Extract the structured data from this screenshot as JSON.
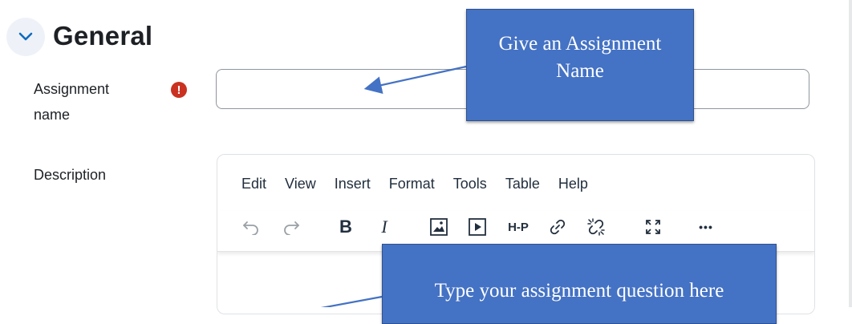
{
  "section": {
    "title": "General"
  },
  "fields": {
    "assignment_name": {
      "label": "Assignment name",
      "label_line1": "Assignment",
      "label_line2": "name",
      "required_icon": "!",
      "value": ""
    },
    "description": {
      "label": "Description"
    }
  },
  "editor": {
    "menu": [
      "Edit",
      "View",
      "Insert",
      "Format",
      "Tools",
      "Table",
      "Help"
    ],
    "toolbar": {
      "undo": "undo-icon",
      "redo": "redo-icon",
      "bold": "B",
      "italic": "I",
      "image": "image-icon",
      "media": "media-icon",
      "h5p": "H-P",
      "link": "link-icon",
      "unlink": "unlink-icon",
      "fullscreen": "fullscreen-icon",
      "more": "•••"
    }
  },
  "annotations": {
    "callout_name_line1": "Give an Assignment",
    "callout_name_line2": "Name",
    "callout_question": "Type your assignment question here"
  },
  "colors": {
    "callout_fill": "#4472c4",
    "required_icon": "#ca3120",
    "chevron": "#0f6cbf"
  }
}
